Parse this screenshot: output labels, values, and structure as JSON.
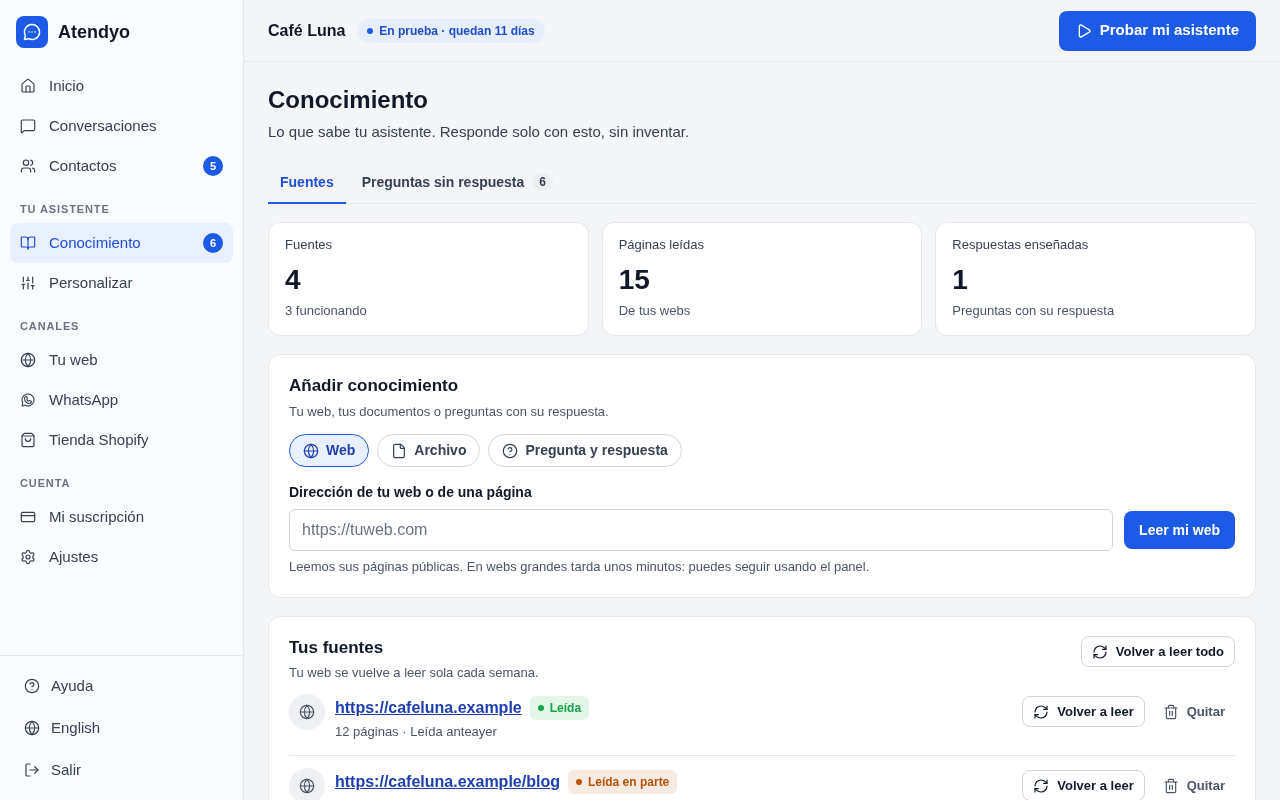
{
  "app": {
    "name": "Atendyo"
  },
  "sidebar": {
    "groups": [
      {
        "items": [
          {
            "label": "Inicio",
            "selected": false
          },
          {
            "label": "Conversaciones",
            "selected": false
          },
          {
            "label": "Contactos",
            "badge": "5",
            "selected": false
          }
        ]
      },
      {
        "heading": "TU ASISTENTE",
        "items": [
          {
            "label": "Conocimiento",
            "badge": "6",
            "selected": true
          },
          {
            "label": "Personalizar",
            "selected": false
          }
        ]
      },
      {
        "heading": "CANALES",
        "items": [
          {
            "label": "Tu web",
            "selected": false
          },
          {
            "label": "WhatsApp",
            "selected": false
          },
          {
            "label": "Tienda Shopify",
            "selected": false
          }
        ]
      },
      {
        "heading": "CUENTA",
        "items": [
          {
            "label": "Mi suscripción",
            "selected": false
          },
          {
            "label": "Ajustes",
            "selected": false
          }
        ]
      }
    ],
    "footer": [
      {
        "label": "Ayuda"
      },
      {
        "label": "English"
      },
      {
        "label": "Salir"
      }
    ]
  },
  "header": {
    "business": "Café Luna",
    "trial_badge": "En prueba · quedan 11 días",
    "primary_button": "Probar mi asistente"
  },
  "page": {
    "title": "Conocimiento",
    "subtitle": "Lo que sabe tu asistente. Responde solo con esto, sin inventar."
  },
  "tabs": [
    {
      "label": "Fuentes",
      "selected": true
    },
    {
      "label": "Preguntas sin respuesta",
      "count": "6",
      "selected": false
    }
  ],
  "stats": [
    {
      "label": "Fuentes",
      "value": "4",
      "caption": "3 funcionando"
    },
    {
      "label": "Páginas leídas",
      "value": "15",
      "caption": "De tus webs"
    },
    {
      "label": "Respuestas enseñadas",
      "value": "1",
      "caption": "Preguntas con su respuesta"
    }
  ],
  "add_knowledge": {
    "title": "Añadir conocimiento",
    "subtitle": "Tu web, tus documentos o preguntas con su respuesta.",
    "source_types": [
      {
        "label": "Web",
        "selected": true
      },
      {
        "label": "Archivo",
        "selected": false
      },
      {
        "label": "Pregunta y respuesta",
        "selected": false
      }
    ],
    "url_field": {
      "label": "Dirección de tu web o de una página",
      "placeholder": "https://tuweb.com"
    },
    "submit_button": "Leer mi web",
    "hint": "Leemos sus páginas públicas. En webs grandes tarda unos minutos: puedes seguir usando el panel."
  },
  "sources": {
    "title": "Tus fuentes",
    "subtitle": "Tu web se vuelve a leer sola cada semana.",
    "refresh_all_button": "Volver a leer todo",
    "items": [
      {
        "url": "https://cafeluna.example",
        "status": "Leída",
        "color": "#16a34a",
        "meta": "12 páginas · Leída anteayer",
        "refresh_button": "Volver a leer",
        "remove_button": "Quitar"
      },
      {
        "url": "https://cafeluna.example/blog",
        "status": "Leída en parte",
        "color": "#b45309",
        "refresh_button": "Volver a leer",
        "remove_button": "Quitar"
      }
    ]
  }
}
